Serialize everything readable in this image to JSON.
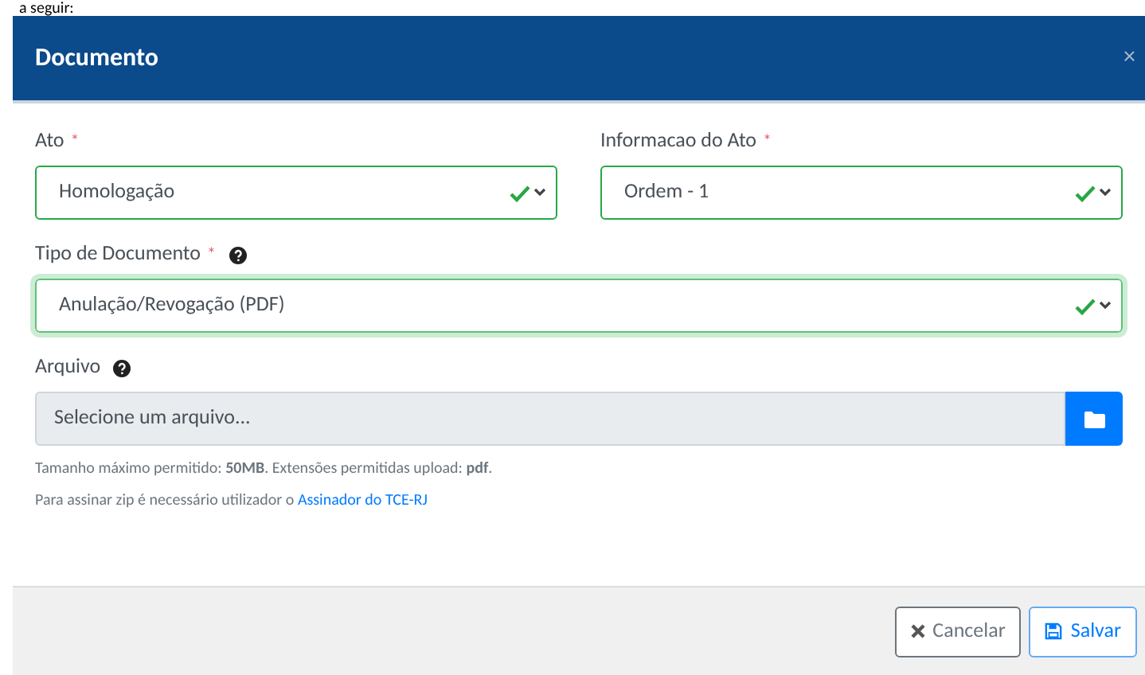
{
  "page_text": "a seguir:",
  "dialog": {
    "title": "Documento",
    "close": "×"
  },
  "fields": [
    {
      "kind": "select",
      "label": "Ato",
      "required": "*",
      "help": false,
      "value": "Homologação",
      "valid": true,
      "focused": false
    },
    {
      "kind": "select",
      "label": "Informacao do Ato",
      "required": "*",
      "help": false,
      "value": "Ordem - 1",
      "valid": true,
      "focused": false
    },
    {
      "kind": "select",
      "label": "Tipo de Documento",
      "required": "*",
      "help": true,
      "value": "Anulação/Revogação (PDF)",
      "valid": true,
      "focused": true
    },
    {
      "kind": "file",
      "label": "Arquivo",
      "help": true,
      "placeholder": "Selecione um arquivo..."
    }
  ],
  "hints": [
    "Tamanho máximo permitido: **50MB**. Extensões permitidas upload: **pdf**."
  ],
  "sign_hint": {
    "text": "Para assinar zip é necessário utilizador o",
    "link": "Assinador do TCE-RJ"
  },
  "buttons": [
    {
      "kind": "cancel",
      "label": "Cancelar"
    },
    {
      "kind": "save",
      "label": "Salvar"
    }
  ]
}
